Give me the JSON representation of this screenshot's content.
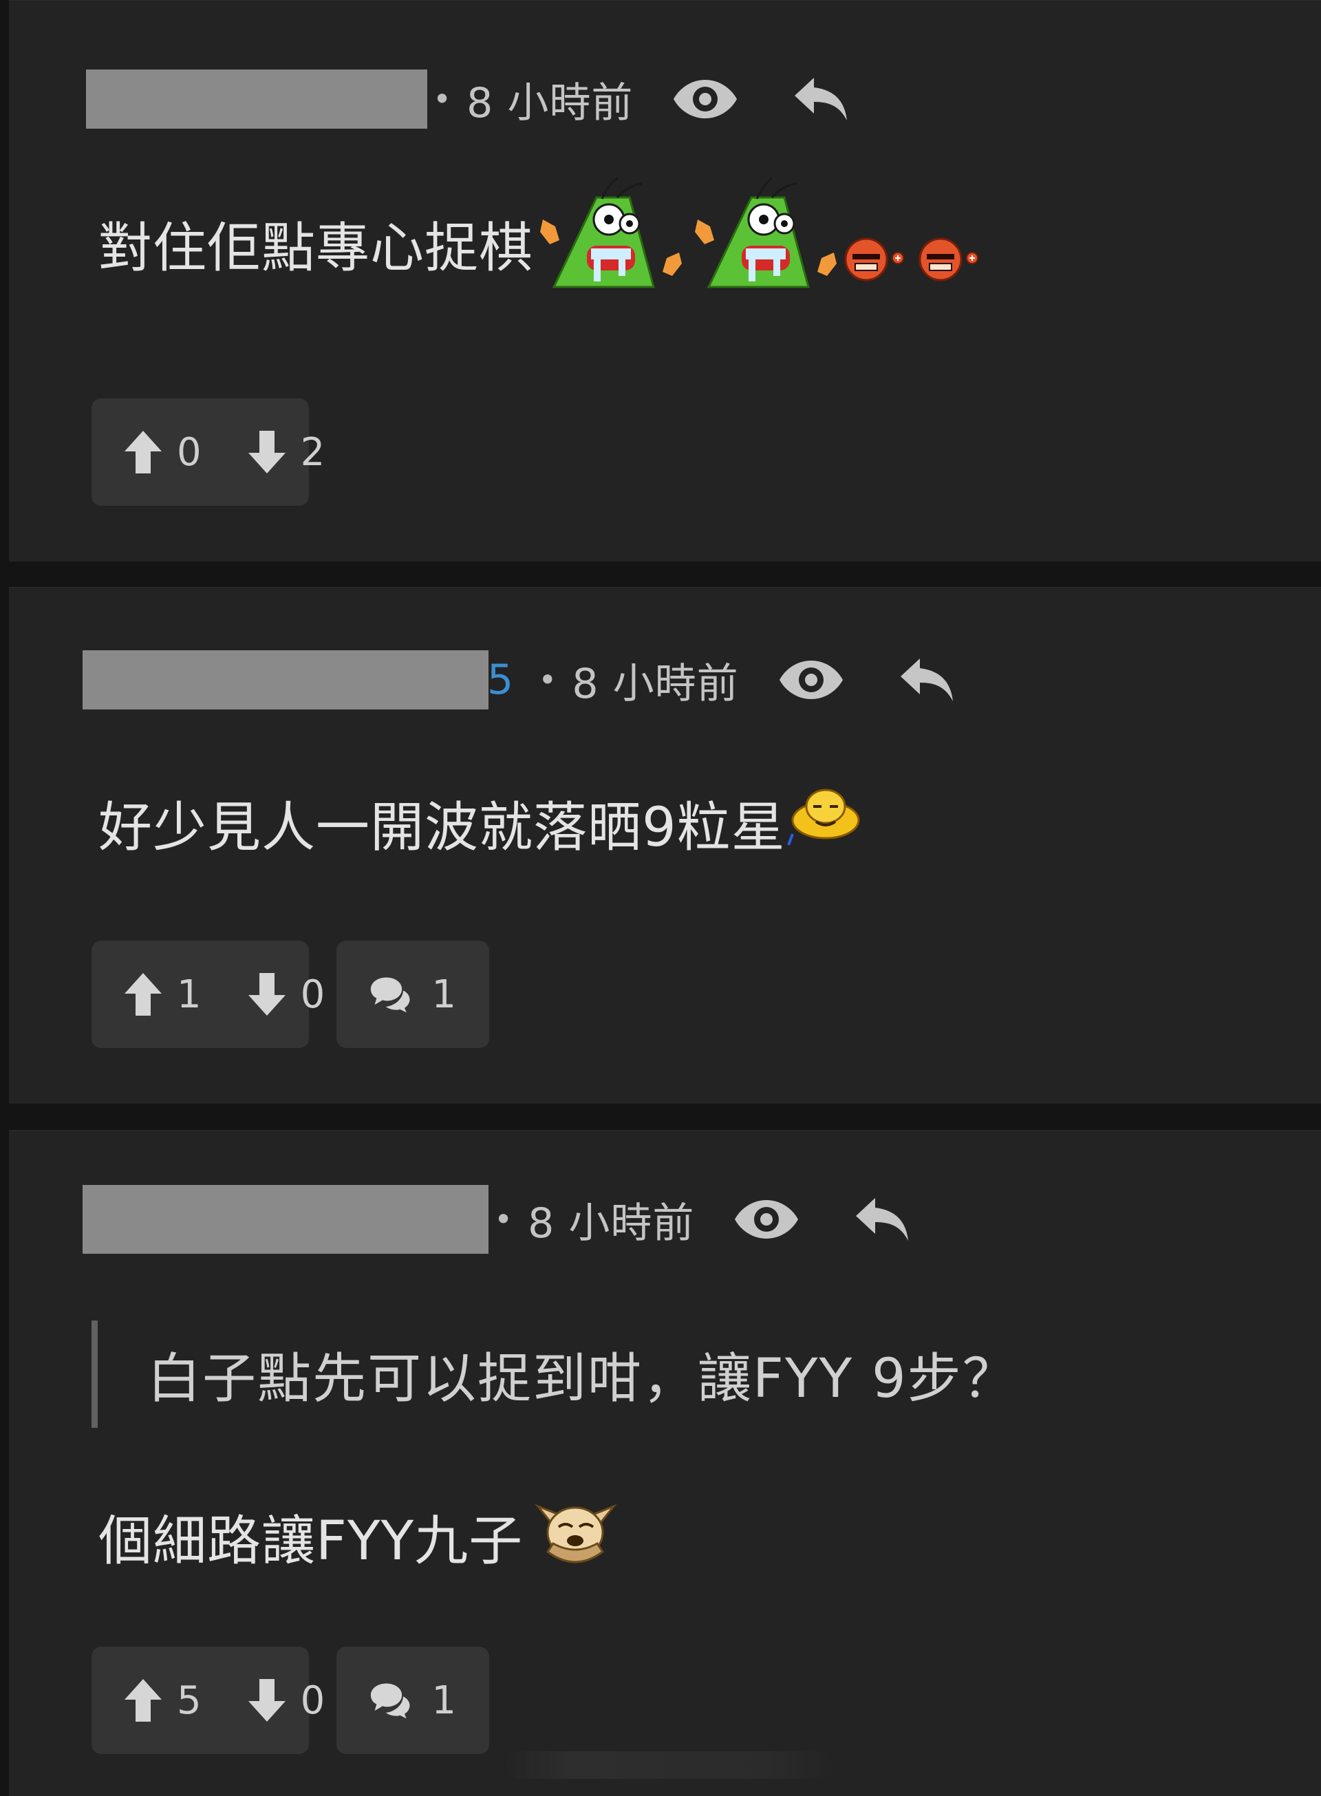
{
  "comments": [
    {
      "time_dot": "•",
      "time": "8 小時前",
      "text": "對住佢點專心捉棋",
      "emoji_icons": [
        "green-monster-crying-emoji",
        "green-monster-crying-emoji",
        "red-bomb-face-emoji",
        "red-bomb-face-emoji"
      ],
      "upvotes": "0",
      "downvotes": "2"
    },
    {
      "name_tail": "5",
      "time_dot": "•",
      "time": "8 小時前",
      "text": "好少見人一開波就落晒9粒星",
      "emoji_icons": [
        "yellow-sweating-face-emoji"
      ],
      "upvotes": "1",
      "downvotes": "0",
      "replies": "1"
    },
    {
      "time_dot": "•",
      "time": "8 小時前",
      "quote": "白子點先可以捉到咁，讓FYY 9步？",
      "text": "個細路讓FYY九子",
      "emoji_icons": [
        "facepalm-dog-emoji"
      ],
      "upvotes": "5",
      "downvotes": "0",
      "replies": "1"
    }
  ],
  "colors": {
    "card_background": "#232323",
    "page_background": "#141414",
    "pill_background": "#343434",
    "username_link": "#3a8fd3",
    "redaction": "#8a8a8a"
  }
}
